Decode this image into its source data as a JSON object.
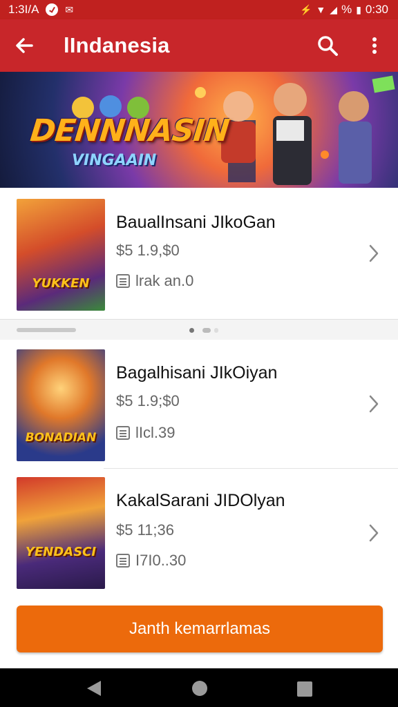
{
  "status_bar": {
    "time": "1:3I/A",
    "battery": "%",
    "clock": "0:30"
  },
  "app_bar": {
    "title": "lIndanesia"
  },
  "banner": {
    "title": "DENNNASIN",
    "subtitle": "VINGAAIN"
  },
  "items": [
    {
      "title": "BaualInsani JIkoGan",
      "price": "$5 1.9,$0",
      "meta": "lrak an.0",
      "thumb_text": "YUKKEN"
    },
    {
      "title": "Bagalhisani JIkOiyan",
      "price": "$5 1.9;$0",
      "meta": "lIcl.39",
      "thumb_text": "BONADIAN"
    },
    {
      "title": "KakalSarani JIDOlyan",
      "price": "$5 11;36",
      "meta": "I7I0..30",
      "thumb_text": "YENDASCI"
    }
  ],
  "cta": {
    "label": "Janth kemarrlamas"
  },
  "colors": {
    "app_bar": "#c8262a",
    "cta": "#ec6a0c"
  }
}
